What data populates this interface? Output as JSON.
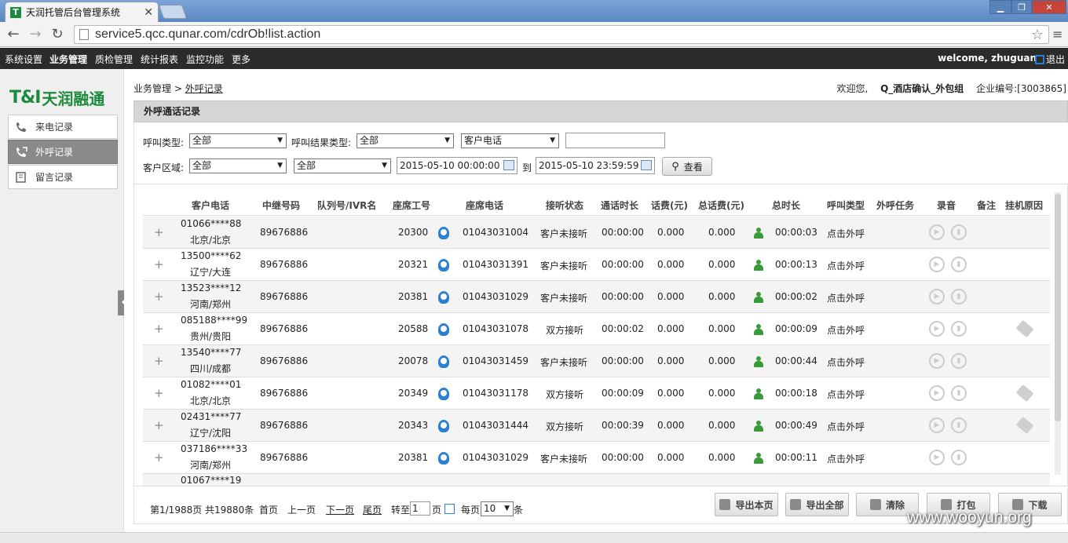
{
  "browser": {
    "tab_title": "天润托管后台管理系统",
    "url": "service5.qcc.qunar.com/cdrOb!list.action"
  },
  "topnav": {
    "items": [
      "系统设置",
      "业务管理",
      "质检管理",
      "统计报表",
      "监控功能",
      "更多"
    ],
    "active": "业务管理",
    "welcome": "welcome, zhuguan",
    "logout": "退出"
  },
  "logo": {
    "mark": "T&I",
    "text": "天润融通"
  },
  "sidebar": {
    "items": [
      {
        "label": "来电记录",
        "icon": "incoming-call-icon"
      },
      {
        "label": "外呼记录",
        "icon": "outgoing-call-icon"
      },
      {
        "label": "留言记录",
        "icon": "voicemail-icon"
      }
    ],
    "active_index": 1
  },
  "breadcrumb": {
    "root": "业务管理",
    "sep": ">",
    "current": "外呼记录"
  },
  "userinfo": {
    "greeting": "欢迎您,",
    "group": "Q_酒店确认_外包组",
    "company_label": "企业编号:[3003865]"
  },
  "panel": {
    "title": "外呼通话记录"
  },
  "filters": {
    "call_type_label": "呼叫类型:",
    "call_type_value": "全部",
    "call_result_label": "呼叫结果类型:",
    "call_result_value": "全部",
    "field_select_value": "客户电话",
    "field_text_value": "",
    "region_label": "客户区域:",
    "region_province": "全部",
    "region_city": "全部",
    "date_from": "2015-05-10 00:00:00",
    "date_to_label": "到",
    "date_to": "2015-05-10 23:59:59",
    "search_label": "查看"
  },
  "table": {
    "columns": [
      "客户电话",
      "中继号码",
      "队列号/IVR名",
      "座席工号",
      "座席电话",
      "接听状态",
      "通话时长",
      "话费(元)",
      "总话费(元)",
      "总时长",
      "呼叫类型",
      "外呼任务",
      "录音",
      "备注",
      "挂机原因"
    ],
    "rows": [
      {
        "phone": "01066****88",
        "region": "北京/北京",
        "trunk": "89676886",
        "agent_id": "20300",
        "agent_phone": "01043031004",
        "status": "客户未接听",
        "talk": "00:00:00",
        "fee": "0.000",
        "total_fee": "0.000",
        "total_time": "00:00:03",
        "call_type": "点击外呼",
        "tag": false
      },
      {
        "phone": "13500****62",
        "region": "辽宁/大连",
        "trunk": "89676886",
        "agent_id": "20321",
        "agent_phone": "01043031391",
        "status": "客户未接听",
        "talk": "00:00:00",
        "fee": "0.000",
        "total_fee": "0.000",
        "total_time": "00:00:13",
        "call_type": "点击外呼",
        "tag": false
      },
      {
        "phone": "13523****12",
        "region": "河南/郑州",
        "trunk": "89676886",
        "agent_id": "20381",
        "agent_phone": "01043031029",
        "status": "客户未接听",
        "talk": "00:00:00",
        "fee": "0.000",
        "total_fee": "0.000",
        "total_time": "00:00:02",
        "call_type": "点击外呼",
        "tag": false
      },
      {
        "phone": "085188****99",
        "region": "贵州/贵阳",
        "trunk": "89676886",
        "agent_id": "20588",
        "agent_phone": "01043031078",
        "status": "双方接听",
        "talk": "00:00:02",
        "fee": "0.000",
        "total_fee": "0.000",
        "total_time": "00:00:09",
        "call_type": "点击外呼",
        "tag": true
      },
      {
        "phone": "13540****77",
        "region": "四川/成都",
        "trunk": "89676886",
        "agent_id": "20078",
        "agent_phone": "01043031459",
        "status": "客户未接听",
        "talk": "00:00:00",
        "fee": "0.000",
        "total_fee": "0.000",
        "total_time": "00:00:44",
        "call_type": "点击外呼",
        "tag": false
      },
      {
        "phone": "01082****01",
        "region": "北京/北京",
        "trunk": "89676886",
        "agent_id": "20349",
        "agent_phone": "01043031178",
        "status": "双方接听",
        "talk": "00:00:09",
        "fee": "0.000",
        "total_fee": "0.000",
        "total_time": "00:00:18",
        "call_type": "点击外呼",
        "tag": true
      },
      {
        "phone": "02431****77",
        "region": "辽宁/沈阳",
        "trunk": "89676886",
        "agent_id": "20343",
        "agent_phone": "01043031444",
        "status": "双方接听",
        "talk": "00:00:39",
        "fee": "0.000",
        "total_fee": "0.000",
        "total_time": "00:00:49",
        "call_type": "点击外呼",
        "tag": true
      },
      {
        "phone": "037186****33",
        "region": "河南/郑州",
        "trunk": "89676886",
        "agent_id": "20381",
        "agent_phone": "01043031029",
        "status": "客户未接听",
        "talk": "00:00:00",
        "fee": "0.000",
        "total_fee": "0.000",
        "total_time": "00:00:11",
        "call_type": "点击外呼",
        "tag": false
      },
      {
        "phone": "01067****19",
        "region": "",
        "trunk": "",
        "agent_id": "",
        "agent_phone": "",
        "status": "",
        "talk": "",
        "fee": "",
        "total_fee": "",
        "total_time": "",
        "call_type": "",
        "tag": false
      }
    ]
  },
  "pager": {
    "summary": "第1/1988页 共19880条",
    "first": "首页",
    "prev": "上一页",
    "next": "下一页",
    "last": "尾页",
    "goto_label": "转至",
    "goto_value": "1",
    "page_unit": "页",
    "per_page_label": "每页",
    "per_page_value": "10",
    "per_page_unit": "条"
  },
  "actions": {
    "export_page": "导出本页",
    "export_all": "导出全部",
    "clear": "清除",
    "pack": "打包",
    "download": "下载"
  },
  "watermark": "www.wooyun.org",
  "colors": {
    "brand_green": "#1c8a3c",
    "nav_bg": "#2b2b2b",
    "agent_blue": "#2d7fd2"
  }
}
